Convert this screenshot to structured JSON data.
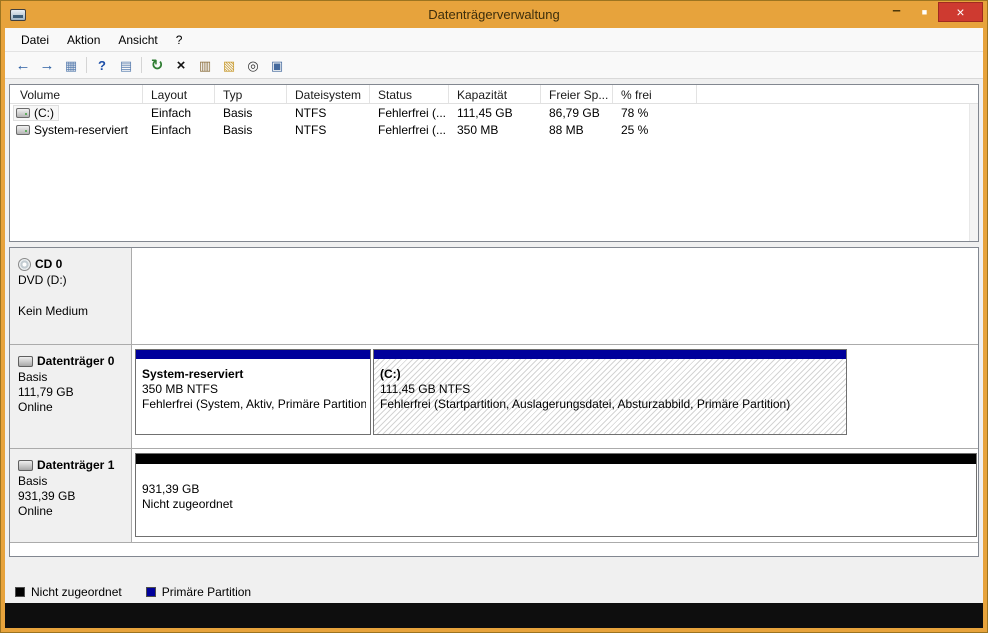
{
  "window": {
    "title": "Datenträgerverwaltung",
    "controls": {
      "minimize": "–",
      "maximize": "■",
      "close": "×"
    }
  },
  "menu": {
    "items": [
      "Datei",
      "Aktion",
      "Ansicht",
      "?"
    ]
  },
  "toolbar": {
    "icons": [
      {
        "name": "back",
        "glyph": "←"
      },
      {
        "name": "forward",
        "glyph": "→"
      },
      {
        "name": "console-tree",
        "glyph": "▦"
      },
      {
        "name": "help",
        "glyph": "?"
      },
      {
        "name": "export-list",
        "glyph": "▤"
      },
      {
        "name": "refresh",
        "glyph": "↻"
      },
      {
        "name": "delete",
        "glyph": "×"
      },
      {
        "name": "properties",
        "glyph": "▥"
      },
      {
        "name": "open",
        "glyph": "▧"
      },
      {
        "name": "find",
        "glyph": "◎"
      },
      {
        "name": "disk-management",
        "glyph": "▣"
      }
    ]
  },
  "volume_list": {
    "columns": [
      "Volume",
      "Layout",
      "Typ",
      "Dateisystem",
      "Status",
      "Kapazität",
      "Freier Sp...",
      "% frei"
    ],
    "rows": [
      {
        "volume": "(C:)",
        "layout": "Einfach",
        "typ": "Basis",
        "fs": "NTFS",
        "status": "Fehlerfrei (...",
        "capacity": "111,45 GB",
        "free": "86,79 GB",
        "pct": "78 %"
      },
      {
        "volume": "System-reserviert",
        "layout": "Einfach",
        "typ": "Basis",
        "fs": "NTFS",
        "status": "Fehlerfrei (...",
        "capacity": "350 MB",
        "free": "88 MB",
        "pct": "25 %"
      }
    ]
  },
  "graphical": {
    "cd": {
      "name": "CD 0",
      "drive": "DVD (D:)",
      "media": "Kein Medium"
    },
    "disks": [
      {
        "name": "Datenträger 0",
        "type": "Basis",
        "size": "111,79 GB",
        "status": "Online",
        "partitions": [
          {
            "name": "System-reserviert",
            "size": "350 MB NTFS",
            "status": "Fehlerfrei (System, Aktiv, Primäre Partition)"
          },
          {
            "name": "(C:)",
            "size": "111,45 GB NTFS",
            "status": "Fehlerfrei (Startpartition, Auslagerungsdatei, Absturzabbild, Primäre Partition)"
          }
        ]
      },
      {
        "name": "Datenträger 1",
        "type": "Basis",
        "size": "931,39 GB",
        "status": "Online",
        "unallocated": {
          "size": "931,39 GB",
          "status": "Nicht zugeordnet"
        }
      }
    ]
  },
  "legend": {
    "items": [
      {
        "label": "Nicht zugeordnet",
        "color": "#000000"
      },
      {
        "label": "Primäre Partition",
        "color": "#00009B"
      }
    ]
  },
  "colors": {
    "titlebar": "#E7A33C",
    "close_button": "#CE3A30",
    "primary_partition": "#00009B",
    "unallocated": "#000000"
  }
}
